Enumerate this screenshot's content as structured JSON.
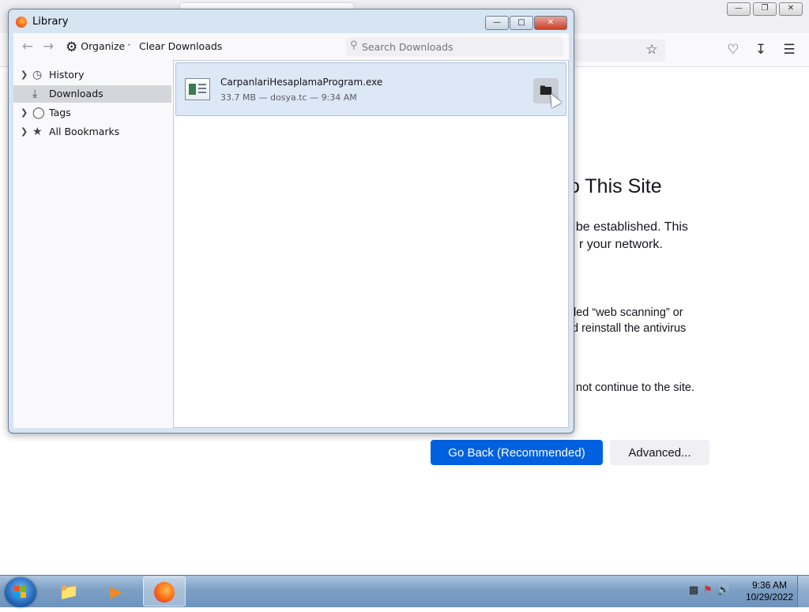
{
  "firefox": {
    "error_title": "o This Site",
    "error_line1": "t be established. This",
    "error_line2": "r your network.",
    "error_line3": "led “web scanning” or",
    "error_line4": "d reinstall the antivirus",
    "error_line5": "not continue to the site.",
    "go_back_label": "Go Back (Recommended)",
    "advanced_label": "Advanced..."
  },
  "library": {
    "title": "Library",
    "organize_label": "Organize",
    "clear_downloads_label": "Clear Downloads",
    "search_placeholder": "Search Downloads",
    "sidebar": {
      "items": [
        {
          "label": "History",
          "icon": "clock-icon",
          "expandable": true,
          "selected": false
        },
        {
          "label": "Downloads",
          "icon": "download-icon",
          "expandable": false,
          "selected": true
        },
        {
          "label": "Tags",
          "icon": "tag-icon",
          "expandable": true,
          "selected": false
        },
        {
          "label": "All Bookmarks",
          "icon": "star-icon",
          "expandable": true,
          "selected": false
        }
      ]
    },
    "downloads": [
      {
        "filename": "CarpanlariHesaplamaProgram.exe",
        "status": "33.7 MB — dosya.tc — 9:34 AM"
      }
    ]
  },
  "taskbar": {
    "time": "9:36 AM",
    "date": "10/29/2022"
  },
  "colors": {
    "accent": "#0061e0",
    "selection": "#dde8f6",
    "taskbar": "#7d9fc4"
  }
}
